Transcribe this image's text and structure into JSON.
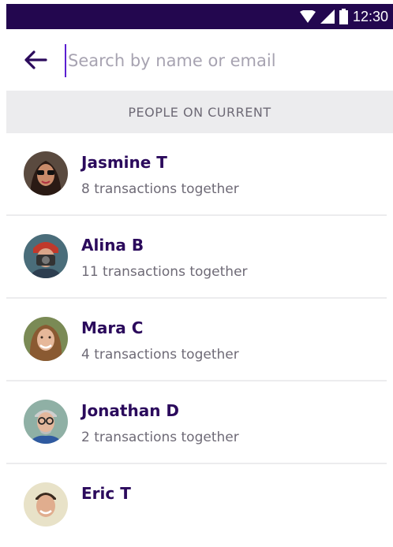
{
  "status_bar": {
    "time": "12:30",
    "bg_color": "#23074f",
    "icons": [
      "wifi-icon",
      "signal-icon",
      "battery-icon"
    ]
  },
  "search": {
    "placeholder": "Search by name or email",
    "value": "",
    "back_icon": "arrow-left-icon",
    "accent": "#5b1fd1"
  },
  "section": {
    "title": "PEOPLE ON CURRENT"
  },
  "people": [
    {
      "name": "Jasmine T",
      "subtitle": "8 transactions together"
    },
    {
      "name": "Alina B",
      "subtitle": "11 transactions together"
    },
    {
      "name": "Mara C",
      "subtitle": "4 transactions together"
    },
    {
      "name": "Jonathan D",
      "subtitle": "2 transactions together"
    },
    {
      "name": "Eric T",
      "subtitle": ""
    }
  ],
  "colors": {
    "name_text": "#2b0a5c",
    "secondary_text": "#6e6a76",
    "section_bg": "#ececee"
  }
}
